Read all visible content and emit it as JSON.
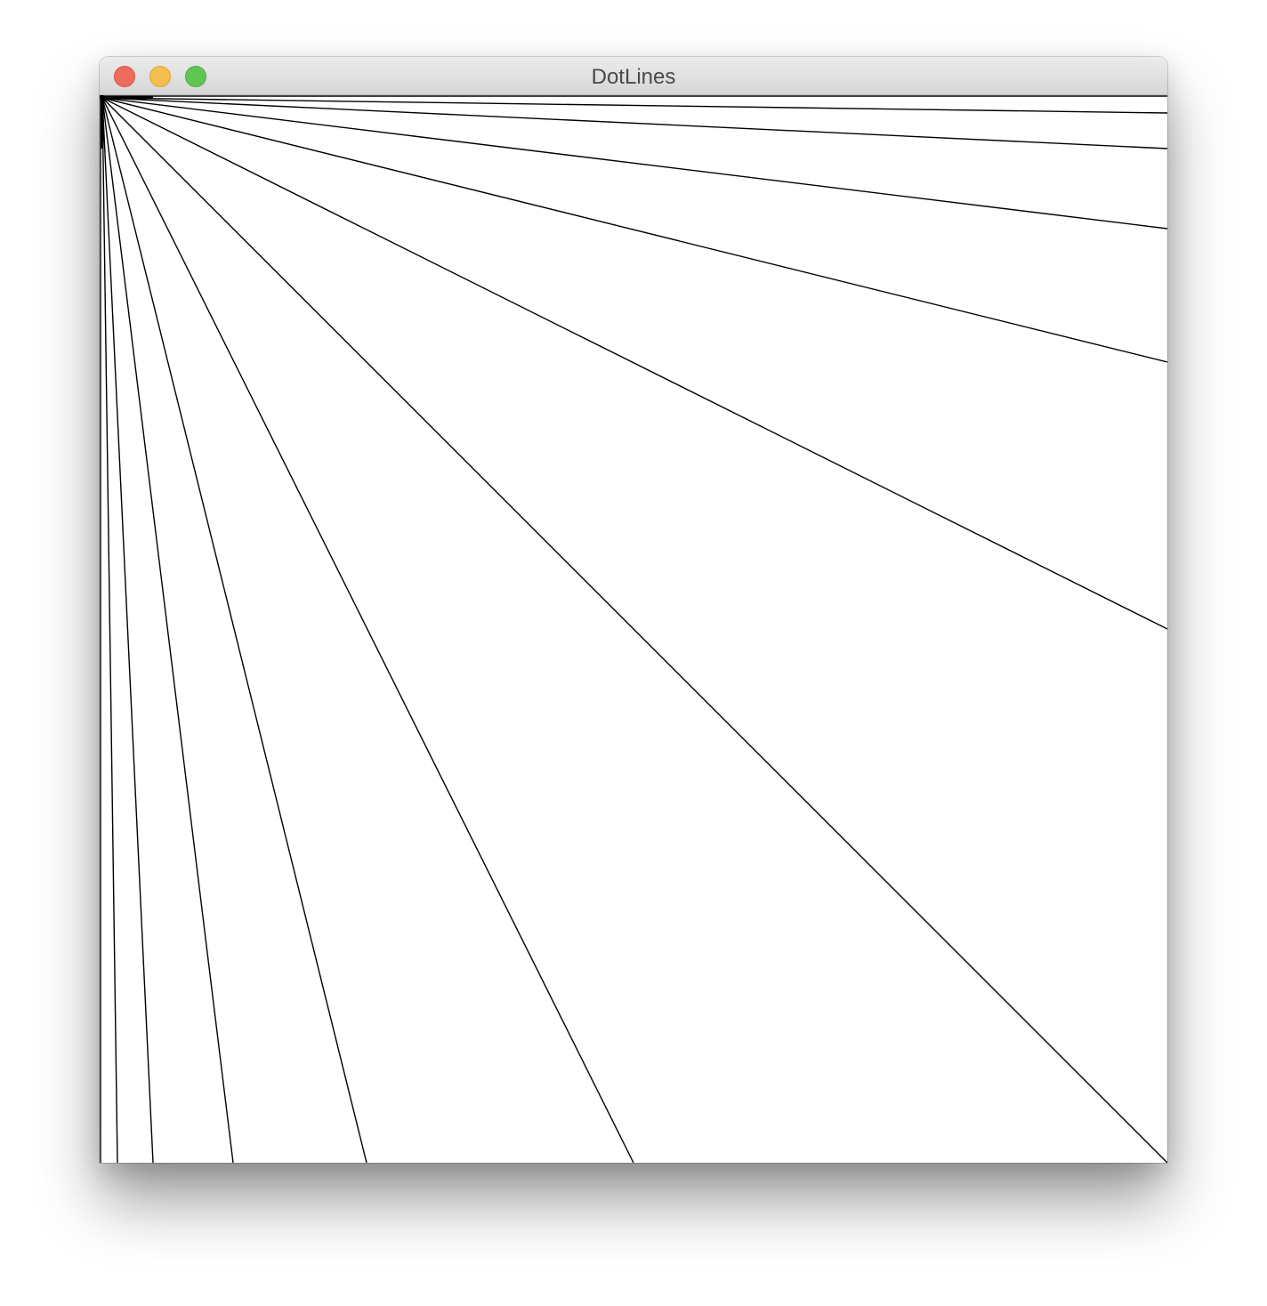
{
  "window": {
    "title": "DotLines",
    "controls": {
      "close": "close-button",
      "minimize": "minimize-button",
      "maximize": "zoom-button"
    }
  },
  "drawing": {
    "line_color": "#000000",
    "background_color": "#ffffff",
    "line_count": 11
  }
}
